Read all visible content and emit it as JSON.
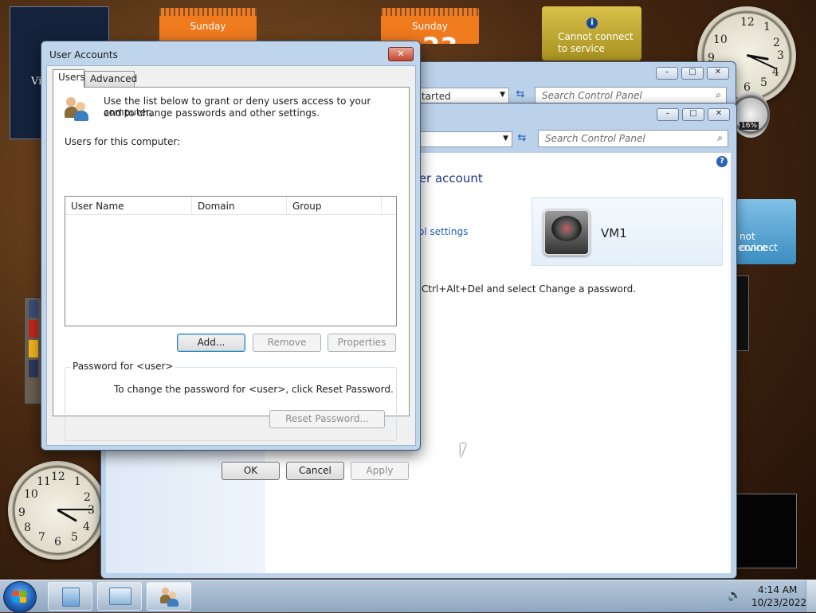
{
  "gadgets": {
    "calendar1_day": "Sunday",
    "calendar2_day": "Sunday",
    "calendar2_date_partial": "23",
    "weather_top": "Cannot connect to service",
    "weather_side": "Cannot connect to service",
    "weather_side_visible_1": "not connect",
    "weather_side_visible_2": "ervice",
    "cpu_percent": "16%",
    "left_panel_text": "Vi"
  },
  "clock_numbers": [
    "12",
    "1",
    "2",
    "3",
    "4",
    "5",
    "6",
    "7",
    "8",
    "9",
    "10",
    "11"
  ],
  "back_window1": {
    "address_text": "tarted",
    "search_placeholder": "Search Control Panel",
    "buttons": {
      "minimize": "–",
      "maximize": "□",
      "close": "✕"
    }
  },
  "back_window2": {
    "address_text": "",
    "search_placeholder": "Search Control Panel",
    "heading_partial": "ser account",
    "link_partial": "ol settings",
    "user_name": "VM1",
    "ctrl_alt_del_text": "Ctrl+Alt+Del and select Change a password.",
    "help_icon": "?",
    "buttons": {
      "minimize": "–",
      "maximize": "□",
      "close": "✕"
    }
  },
  "dialog": {
    "title": "User Accounts",
    "close_label": "✕",
    "tabs": [
      {
        "label": "Users",
        "active": true
      },
      {
        "label": "Advanced",
        "active": false
      }
    ],
    "intro_text_1": "Use the list below to grant or deny users access to your computer,",
    "intro_text_2": "and to change passwords and other settings.",
    "users_label": "Users for this computer:",
    "columns": [
      "User Name",
      "Domain",
      "Group"
    ],
    "list_buttons": {
      "add": "Add...",
      "remove": "Remove",
      "properties": "Properties"
    },
    "password_group_label": "Password for <user>",
    "password_text": "To change the password for <user>, click Reset Password.",
    "reset_button": "Reset Password...",
    "footer_buttons": {
      "ok": "OK",
      "cancel": "Cancel",
      "apply": "Apply"
    }
  },
  "taskbar": {
    "time": "4:14 AM",
    "date": "10/23/2022"
  }
}
